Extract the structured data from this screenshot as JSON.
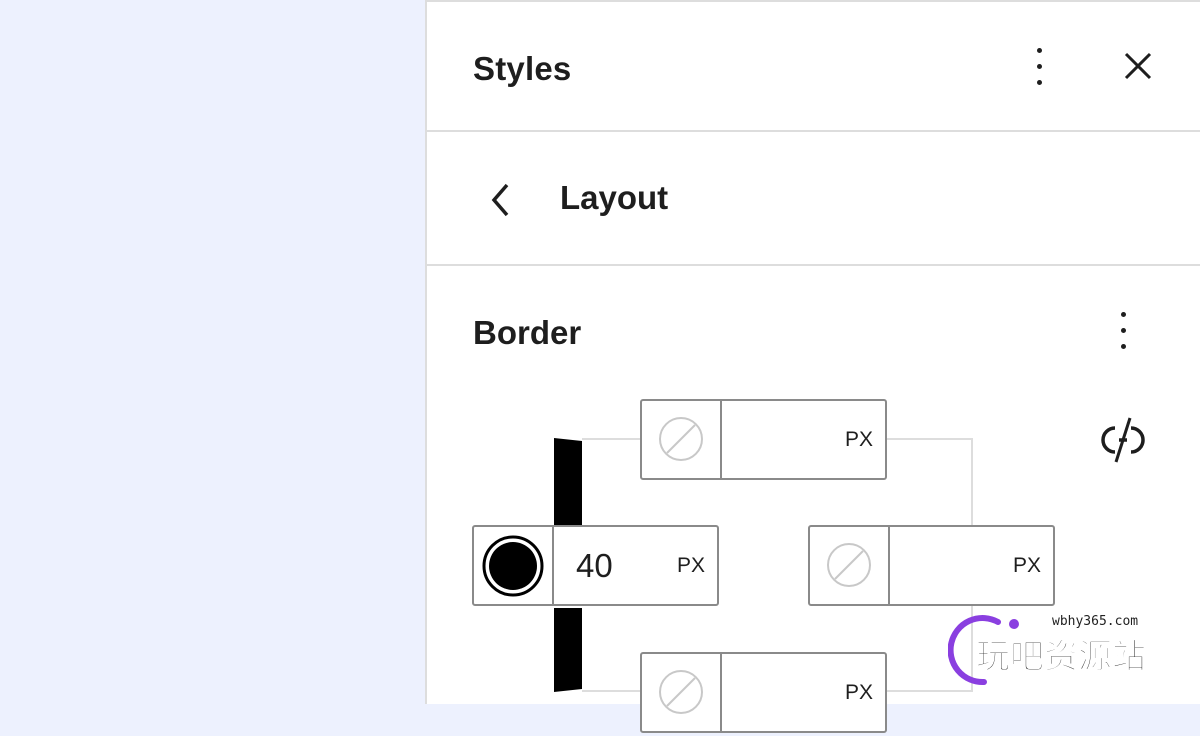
{
  "header": {
    "title": "Styles"
  },
  "nav": {
    "title": "Layout"
  },
  "border": {
    "title": "Border",
    "left_value": "40",
    "unit_top": "PX",
    "unit_left": "PX",
    "unit_right": "PX",
    "unit_bottom": "PX"
  },
  "watermark": {
    "url": "wbhy365.com",
    "text": "玩吧资源站"
  },
  "colors": {
    "canvas": "#edf1fe",
    "border_color": "#000000",
    "field_border": "#8a8a8a"
  },
  "icons": [
    "more-vertical-icon",
    "close-icon",
    "chevron-left-icon",
    "more-vertical-icon",
    "no-color-icon",
    "unlink-icon",
    "color-swatch-icon"
  ]
}
